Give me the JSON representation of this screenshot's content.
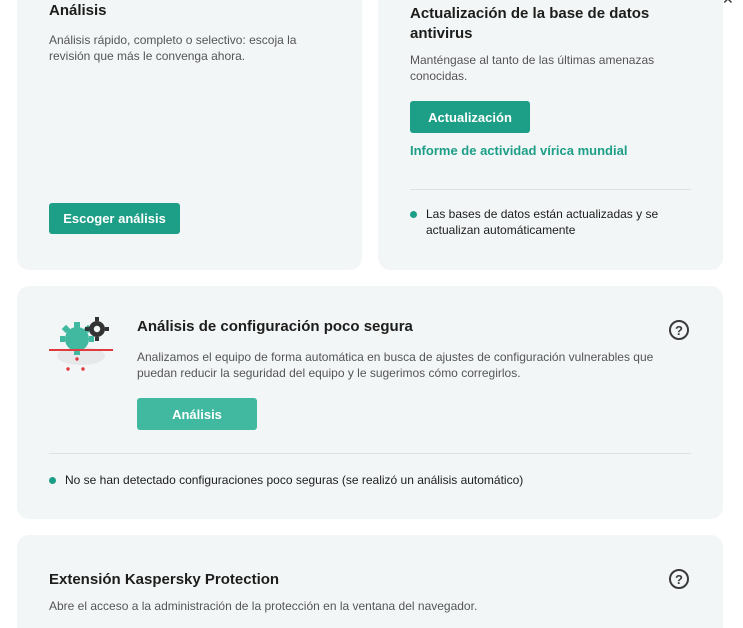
{
  "window": {
    "help_glyph": "?",
    "minimize_glyph": "—",
    "maximize_glyph": "☐",
    "close_glyph": "✕"
  },
  "scan_card": {
    "title": "Análisis",
    "description": "Análisis rápido, completo o selectivo: escoja la revisión que más le convenga ahora.",
    "button_label": "Escoger análisis"
  },
  "update_card": {
    "title": "Actualización de la base de datos antivirus",
    "description": "Manténgase al tanto de las últimas amenazas conocidas.",
    "button_label": "Actualización",
    "link_label": "Informe de actividad vírica mundial",
    "status": "Las bases de datos están actualizadas y se actualizan automáticamente"
  },
  "config_card": {
    "title": "Análisis de configuración poco segura",
    "description": "Analizamos el equipo de forma automática en busca de ajustes de configuración vulnerables que puedan reducir la seguridad del equipo y le sugerimos cómo corregirlos.",
    "button_label": "Análisis",
    "help_glyph": "?",
    "status": "No se han detectado configuraciones poco seguras (se realizó un análisis automático)"
  },
  "extension_card": {
    "title": "Extensión Kaspersky Protection",
    "description": "Abre el acceso a la administración de la protección en la ventana del navegador.",
    "help_glyph": "?"
  },
  "colors": {
    "accent": "#1d9e86",
    "accent_light": "#41b9a0",
    "card_bg": "#f3f6f7",
    "alert_red": "#e0393e"
  }
}
